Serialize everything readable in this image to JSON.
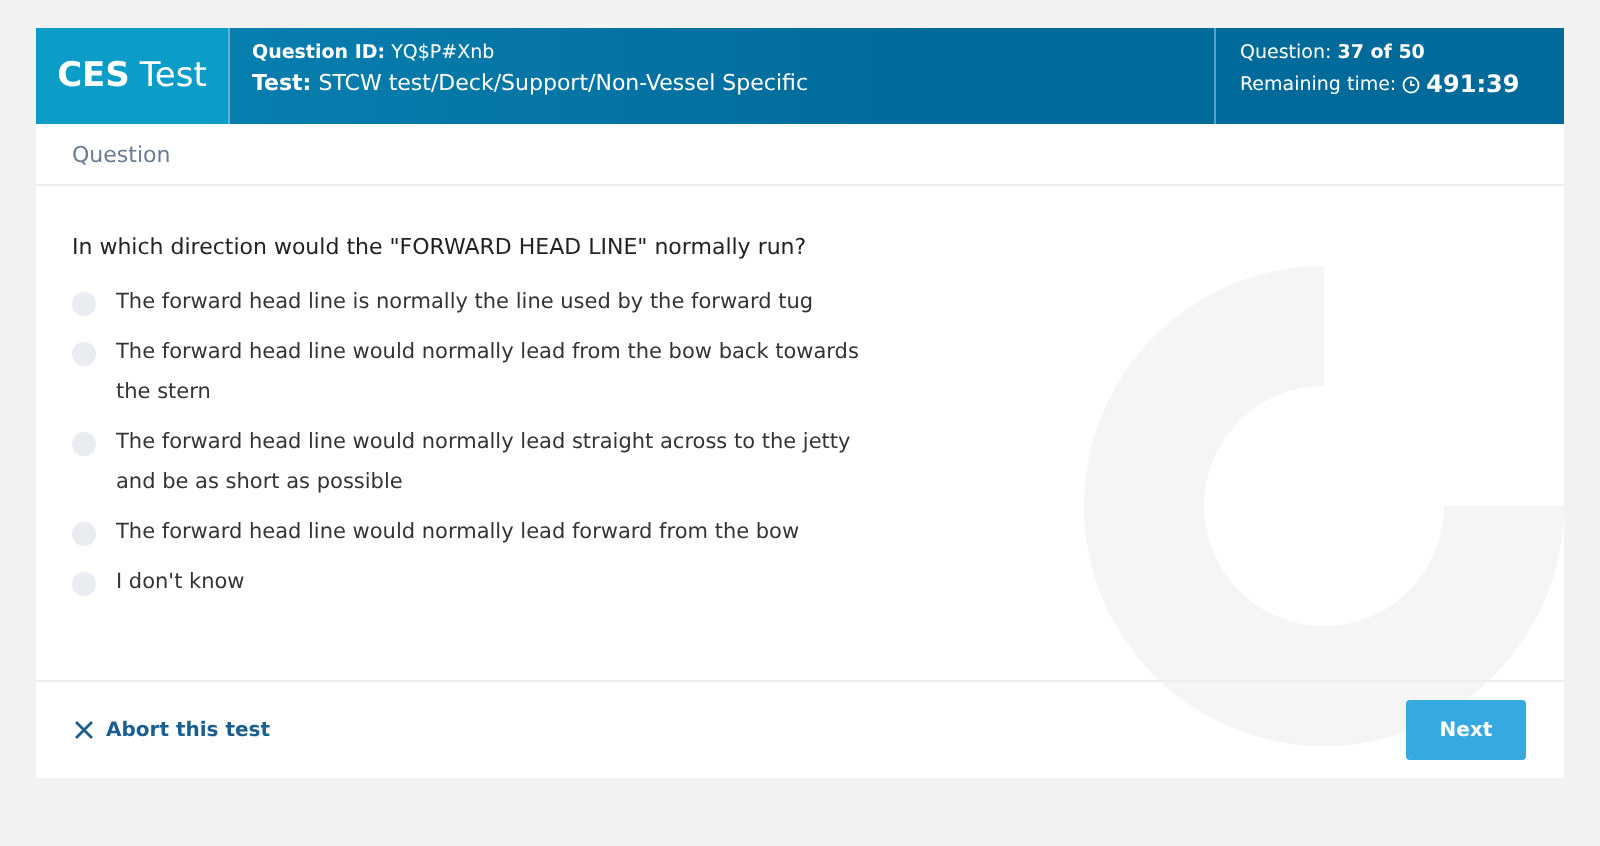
{
  "header": {
    "logo_strong": "CES",
    "logo_rest": "Test",
    "question_id": "**Question ID:** YQ$P#Xnb",
    "test": "**Test:** STCW test/Deck/Support/Non-Vessel Specific",
    "progress_label": "Question:",
    "progress_value": "37 of 50",
    "remaining_label": "Remaining time:",
    "remaining_time": "491:39"
  },
  "section_title": "Question",
  "question": "In which direction would the \"FORWARD HEAD LINE\" normally run?",
  "options": [
    {
      "text": "The forward head line is normally the line used by the forward tug",
      "selected": false
    },
    {
      "text": "The forward head line would normally lead from the bow back towards the stern",
      "selected": false
    },
    {
      "text": "The forward head line would normally lead straight across to the jetty and be as short as possible",
      "selected": false
    },
    {
      "text": "The forward head line would normally lead forward from the bow",
      "selected": false
    },
    {
      "text": "I don't know",
      "selected": false
    }
  ],
  "footer": {
    "abort": "Abort this test",
    "next": "Next"
  }
}
